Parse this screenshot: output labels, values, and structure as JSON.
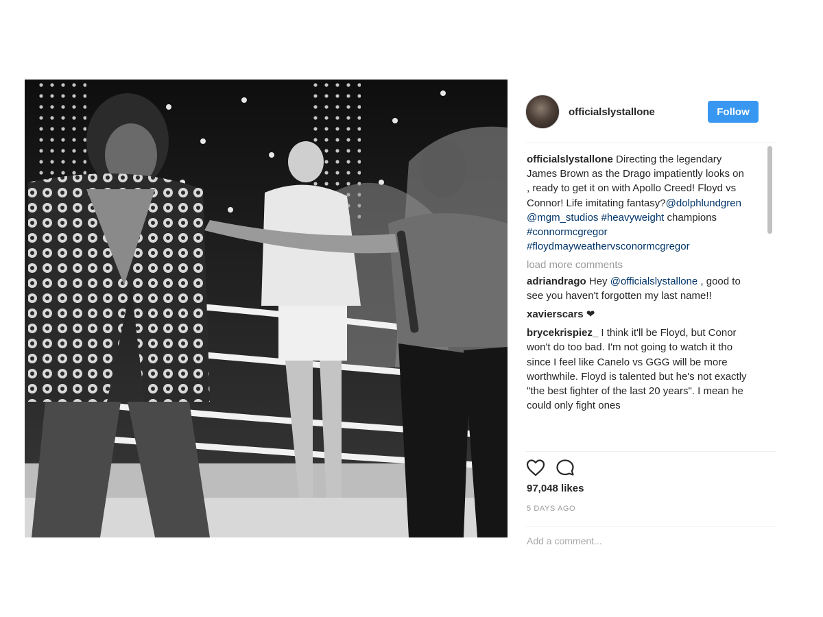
{
  "post": {
    "username": "officialslystallone",
    "follow_label": "Follow",
    "caption": {
      "username": "officialslystallone",
      "text": "Directing the legendary James Brown as the Drago impatiently looks on , ready to get it on with Apollo Creed! Floyd vs Connor! Life imitating fantasy?",
      "mentions": [
        "@dolphlundgren",
        "@mgm_studios",
        "#heavyweight"
      ],
      "middle": "champions",
      "tags": [
        "#connormcgregor",
        "#floydmayweathervsconormcgregor"
      ]
    },
    "load_more": "load more comments",
    "comments": [
      {
        "username": "adriandrago",
        "pre": "Hey",
        "mention": "@officialslystallone",
        "text": ", good to see you haven't forgotten my last name!!"
      },
      {
        "username": "xavierscars",
        "text": "❤"
      },
      {
        "username": "brycekrispiez_",
        "text": "I think it'll be Floyd, but Conor won't do too bad. I'm not going to watch it tho since I feel like Canelo vs GGG will be more worthwhile. Floyd is talented but he's not exactly \"the best fighter of the last 20 years\". I mean he could only fight ones"
      }
    ],
    "likes": "97,048 likes",
    "time": "5 DAYS AGO",
    "add_comment_placeholder": "Add a comment..."
  },
  "icons": {
    "like": "heart-icon",
    "comment": "comment-bubble-icon"
  },
  "colors": {
    "follow": "#3897f0",
    "link": "#003569",
    "muted": "#999999"
  }
}
